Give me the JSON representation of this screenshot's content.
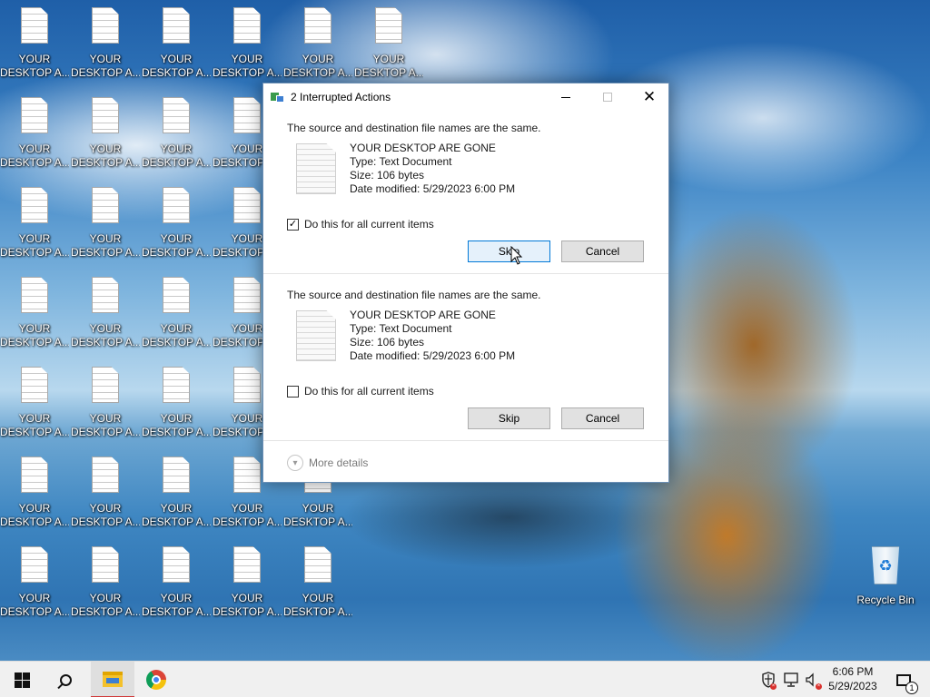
{
  "desktop": {
    "file_label_line1": "YOUR",
    "file_label_line2": "DESKTOP A...",
    "recycle_bin_label": "Recycle Bin"
  },
  "dialog": {
    "title": "2 Interrupted Actions",
    "items": [
      {
        "message": "The source and destination file names are the same.",
        "file_name": "YOUR DESKTOP ARE GONE",
        "type": "Type: Text Document",
        "size": "Size: 106 bytes",
        "date_modified": "Date modified: 5/29/2023 6:00 PM",
        "checkbox_label": "Do this for all current items",
        "checked": true,
        "skip_label": "Skip",
        "cancel_label": "Cancel"
      },
      {
        "message": "The source and destination file names are the same.",
        "file_name": "YOUR DESKTOP ARE GONE",
        "type": "Type: Text Document",
        "size": "Size: 106 bytes",
        "date_modified": "Date modified: 5/29/2023 6:00 PM",
        "checkbox_label": "Do this for all current items",
        "checked": false,
        "skip_label": "Skip",
        "cancel_label": "Cancel"
      }
    ],
    "more_details_label": "More details"
  },
  "taskbar": {
    "time": "6:06 PM",
    "date": "5/29/2023",
    "notification_count": "1",
    "pinned": [
      "windows-start",
      "search",
      "file-explorer",
      "chrome"
    ]
  },
  "colors": {
    "focus_border": "#0078d7",
    "active_app_underline": "#d03a3a"
  }
}
